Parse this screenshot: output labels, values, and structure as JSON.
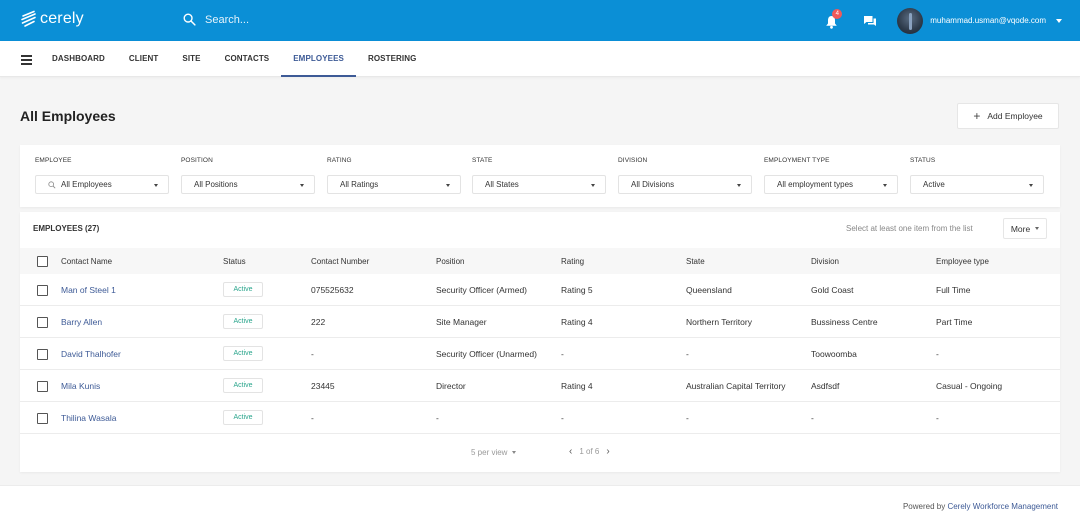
{
  "app": {
    "brand": "cerely",
    "search_placeholder": "Search...",
    "notifications_count": "4",
    "user_email": "muhammad.usman@vqode.com",
    "colors": {
      "primary": "#0b8fd6",
      "accent": "#3d5a96",
      "active_status": "#2aa58c",
      "badge": "#f05a5a"
    }
  },
  "nav": {
    "tabs": [
      {
        "label": "DASHBOARD",
        "active": false
      },
      {
        "label": "CLIENT",
        "active": false
      },
      {
        "label": "SITE",
        "active": false
      },
      {
        "label": "CONTACTS",
        "active": false
      },
      {
        "label": "EMPLOYEES",
        "active": true
      },
      {
        "label": "ROSTERING",
        "active": false
      }
    ]
  },
  "page": {
    "title": "All Employees",
    "add_button": "Add Employee"
  },
  "filters": [
    {
      "label": "EMPLOYEE",
      "value": "All Employees",
      "search_icon": true
    },
    {
      "label": "POSITION",
      "value": "All Positions"
    },
    {
      "label": "RATING",
      "value": "All Ratings"
    },
    {
      "label": "STATE",
      "value": "All States"
    },
    {
      "label": "DIVISION",
      "value": "All Divisions"
    },
    {
      "label": "EMPLOYMENT TYPE",
      "value": "All employment types"
    },
    {
      "label": "STATUS",
      "value": "Active"
    }
  ],
  "table": {
    "heading": "EMPLOYEES (27)",
    "select_hint": "Select at least one item from the list",
    "more_label": "More",
    "columns": [
      "Contact Name",
      "Status",
      "Contact Number",
      "Position",
      "Rating",
      "State",
      "Division",
      "Employee type"
    ],
    "rows": [
      {
        "name": "Man of Steel 1",
        "status": "Active",
        "contact": "075525632",
        "position": "Security Officer (Armed)",
        "rating": "Rating 5",
        "state": "Queensland",
        "division": "Gold Coast",
        "type": "Full Time"
      },
      {
        "name": "Barry Allen",
        "status": "Active",
        "contact": "222",
        "position": "Site Manager",
        "rating": "Rating 4",
        "state": "Northern Territory",
        "division": "Bussiness Centre",
        "type": "Part Time"
      },
      {
        "name": "David Thalhofer",
        "status": "Active",
        "contact": "-",
        "position": "Security Officer (Unarmed)",
        "rating": "-",
        "state": "-",
        "division": "Toowoomba",
        "type": "-"
      },
      {
        "name": "Mila Kunis",
        "status": "Active",
        "contact": "23445",
        "position": "Director",
        "rating": "Rating 4",
        "state": "Australian Capital Territory",
        "division": "Asdfsdf",
        "type": "Casual - Ongoing"
      },
      {
        "name": "Thilina Wasala",
        "status": "Active",
        "contact": "-",
        "position": "-",
        "rating": "-",
        "state": "-",
        "division": "-",
        "type": "-"
      }
    ],
    "pagination": {
      "per_view": "5 per view",
      "page_text": "1 of 6"
    }
  },
  "footer": {
    "powered_by": "Powered by",
    "link": "Cerely Workforce Management"
  }
}
